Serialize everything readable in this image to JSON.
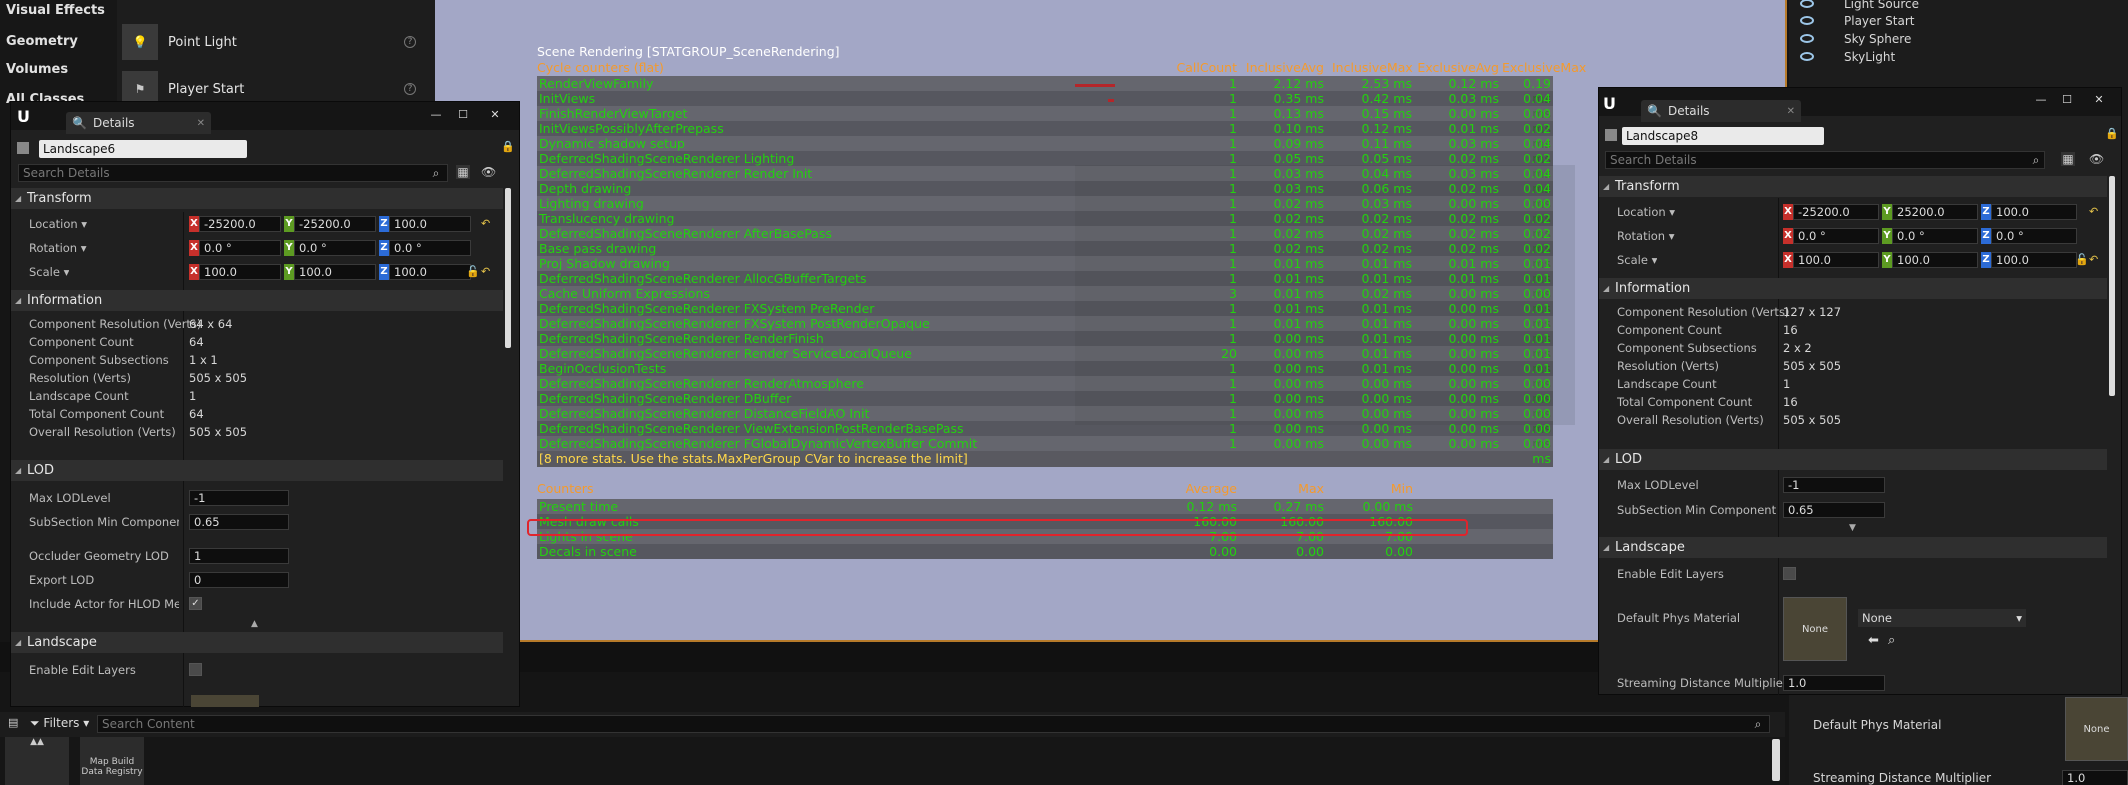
{
  "left_background": {
    "categories": [
      "Visual Effects",
      "Geometry",
      "Volumes",
      "All Classes"
    ],
    "items": [
      "Point Light",
      "Player Start"
    ]
  },
  "outliner": {
    "rows": [
      "Light Source",
      "Player Start",
      "Sky Sphere",
      "SkyLight"
    ]
  },
  "stats": {
    "title": "Scene Rendering [STATGROUP_SceneRendering]",
    "cycle_header": "Cycle counters (flat)",
    "columns": [
      "CallCount",
      "InclusiveAvg",
      "InclusiveMax",
      "ExclusiveAvg",
      "ExclusiveMax"
    ],
    "rows": [
      [
        "RenderViewFamily",
        "1",
        "2.12 ms",
        "2.53 ms",
        "0.12 ms",
        "0.19 ms"
      ],
      [
        "InitViews",
        "1",
        "0.35 ms",
        "0.42 ms",
        "0.03 ms",
        "0.04 ms"
      ],
      [
        "FinishRenderViewTarget",
        "1",
        "0.13 ms",
        "0.15 ms",
        "0.00 ms",
        "0.00 ms"
      ],
      [
        "InitViewsPossiblyAfterPrepass",
        "1",
        "0.10 ms",
        "0.12 ms",
        "0.01 ms",
        "0.02 ms"
      ],
      [
        "Dynamic shadow setup",
        "1",
        "0.09 ms",
        "0.11 ms",
        "0.03 ms",
        "0.04 ms"
      ],
      [
        "DeferredShadingSceneRenderer Lighting",
        "1",
        "0.05 ms",
        "0.05 ms",
        "0.02 ms",
        "0.02 ms"
      ],
      [
        "DeferredShadingSceneRenderer Render Init",
        "1",
        "0.03 ms",
        "0.04 ms",
        "0.03 ms",
        "0.04 ms"
      ],
      [
        "Depth drawing",
        "1",
        "0.03 ms",
        "0.06 ms",
        "0.02 ms",
        "0.04 ms"
      ],
      [
        "Lighting drawing",
        "1",
        "0.02 ms",
        "0.03 ms",
        "0.00 ms",
        "0.00 ms"
      ],
      [
        "Translucency drawing",
        "1",
        "0.02 ms",
        "0.02 ms",
        "0.02 ms",
        "0.02 ms"
      ],
      [
        "DeferredShadingSceneRenderer AfterBasePass",
        "1",
        "0.02 ms",
        "0.02 ms",
        "0.02 ms",
        "0.02 ms"
      ],
      [
        "Base pass drawing",
        "1",
        "0.02 ms",
        "0.02 ms",
        "0.02 ms",
        "0.02 ms"
      ],
      [
        "Proj Shadow drawing",
        "1",
        "0.01 ms",
        "0.01 ms",
        "0.01 ms",
        "0.01 ms"
      ],
      [
        "DeferredShadingSceneRenderer AllocGBufferTargets",
        "1",
        "0.01 ms",
        "0.01 ms",
        "0.01 ms",
        "0.01 ms"
      ],
      [
        "Cache Uniform Expressions",
        "3",
        "0.01 ms",
        "0.02 ms",
        "0.00 ms",
        "0.00 ms"
      ],
      [
        "DeferredShadingSceneRenderer FXSystem PreRender",
        "1",
        "0.01 ms",
        "0.01 ms",
        "0.00 ms",
        "0.01 ms"
      ],
      [
        "DeferredShadingSceneRenderer FXSystem PostRenderOpaque",
        "1",
        "0.01 ms",
        "0.01 ms",
        "0.00 ms",
        "0.01 ms"
      ],
      [
        "DeferredShadingSceneRenderer RenderFinish",
        "1",
        "0.00 ms",
        "0.01 ms",
        "0.00 ms",
        "0.01 ms"
      ],
      [
        "DeferredShadingSceneRenderer Render ServiceLocalQueue",
        "20",
        "0.00 ms",
        "0.01 ms",
        "0.00 ms",
        "0.01 ms"
      ],
      [
        "BeginOcclusionTests",
        "1",
        "0.00 ms",
        "0.01 ms",
        "0.00 ms",
        "0.01 ms"
      ],
      [
        "DeferredShadingSceneRenderer RenderAtmosphere",
        "1",
        "0.00 ms",
        "0.00 ms",
        "0.00 ms",
        "0.00 ms"
      ],
      [
        "DeferredShadingSceneRenderer DBuffer",
        "1",
        "0.00 ms",
        "0.00 ms",
        "0.00 ms",
        "0.00 ms"
      ],
      [
        "DeferredShadingSceneRenderer DistanceFieldAO Init",
        "1",
        "0.00 ms",
        "0.00 ms",
        "0.00 ms",
        "0.00 ms"
      ],
      [
        "DeferredShadingSceneRenderer ViewExtensionPostRenderBasePass",
        "1",
        "0.00 ms",
        "0.00 ms",
        "0.00 ms",
        "0.00 ms"
      ],
      [
        "DeferredShadingSceneRenderer FGlobalDynamicVertexBuffer Commit",
        "1",
        "0.00 ms",
        "0.00 ms",
        "0.00 ms",
        "0.00 ms"
      ]
    ],
    "more_note": "[8 more stats. Use the stats.MaxPerGroup CVar to increase the limit]",
    "counters_header": "Counters",
    "counter_columns": [
      "Average",
      "Max",
      "Min"
    ],
    "counters": [
      [
        "Present time",
        "0.12 ms",
        "0.27 ms",
        "0.00 ms"
      ],
      [
        "Mesh draw calls",
        "160.00",
        "160.00",
        "160.00"
      ],
      [
        "Lights in scene",
        "7.00",
        "7.00",
        "7.00"
      ],
      [
        "Decals in scene",
        "0.00",
        "0.00",
        "0.00"
      ]
    ]
  },
  "details_left": {
    "tab": "Details",
    "actor_name": "Landscape6",
    "search_placeholder": "Search Details",
    "transform_header": "Transform",
    "location_label": "Location",
    "rotation_label": "Rotation",
    "scale_label": "Scale",
    "location": [
      "-25200.0",
      "-25200.0",
      "100.0"
    ],
    "rotation": [
      "0.0 °",
      "0.0 °",
      "0.0 °"
    ],
    "scale": [
      "100.0",
      "100.0",
      "100.0"
    ],
    "info_header": "Information",
    "info": [
      [
        "Component Resolution (Verts)",
        "64 x 64"
      ],
      [
        "Component Count",
        "64"
      ],
      [
        "Component Subsections",
        "1 x 1"
      ],
      [
        "Resolution (Verts)",
        "505 x 505"
      ],
      [
        "Landscape Count",
        "1"
      ],
      [
        "Total Component Count",
        "64"
      ],
      [
        "Overall Resolution (Verts)",
        "505 x 505"
      ]
    ],
    "lod_header": "LOD",
    "lod": [
      [
        "Max LODLevel",
        "-1"
      ],
      [
        "SubSection Min Component Sc",
        "0.65"
      ],
      [
        "Occluder Geometry LOD",
        "1"
      ],
      [
        "Export LOD",
        "0"
      ],
      [
        "Include Actor for HLOD Mesh g",
        ""
      ]
    ],
    "landscape_header": "Landscape",
    "enable_edit_layers": "Enable Edit Layers"
  },
  "details_right": {
    "tab": "Details",
    "actor_name": "Landscape8",
    "search_placeholder": "Search Details",
    "transform_header": "Transform",
    "location_label": "Location",
    "rotation_label": "Rotation",
    "scale_label": "Scale",
    "location": [
      "-25200.0",
      "25200.0",
      "100.0"
    ],
    "rotation": [
      "0.0 °",
      "0.0 °",
      "0.0 °"
    ],
    "scale": [
      "100.0",
      "100.0",
      "100.0"
    ],
    "info_header": "Information",
    "info": [
      [
        "Component Resolution (Verts)",
        "127 x 127"
      ],
      [
        "Component Count",
        "16"
      ],
      [
        "Component Subsections",
        "2 x 2"
      ],
      [
        "Resolution (Verts)",
        "505 x 505"
      ],
      [
        "Landscape Count",
        "1"
      ],
      [
        "Total Component Count",
        "16"
      ],
      [
        "Overall Resolution (Verts)",
        "505 x 505"
      ]
    ],
    "lod_header": "LOD",
    "lod": [
      [
        "Max LODLevel",
        "-1"
      ],
      [
        "SubSection Min Component Scr",
        "0.65"
      ]
    ],
    "landscape_header": "Landscape",
    "enable_edit_layers": "Enable Edit Layers",
    "phys_material_label": "Default Phys Material",
    "phys_material_value": "None",
    "phys_thumb": "None",
    "streaming_label": "Streaming Distance Multiplier",
    "streaming_value": "1.0"
  },
  "bg_right_bottom": {
    "phys_material_label": "Default Phys Material",
    "phys_thumb": "None",
    "streaming_label": "Streaming Distance Multiplier",
    "streaming_value": "1.0"
  },
  "content": {
    "filters": "Filters",
    "search_placeholder": "Search Content",
    "asset_label": "Map Build Data Registry"
  }
}
